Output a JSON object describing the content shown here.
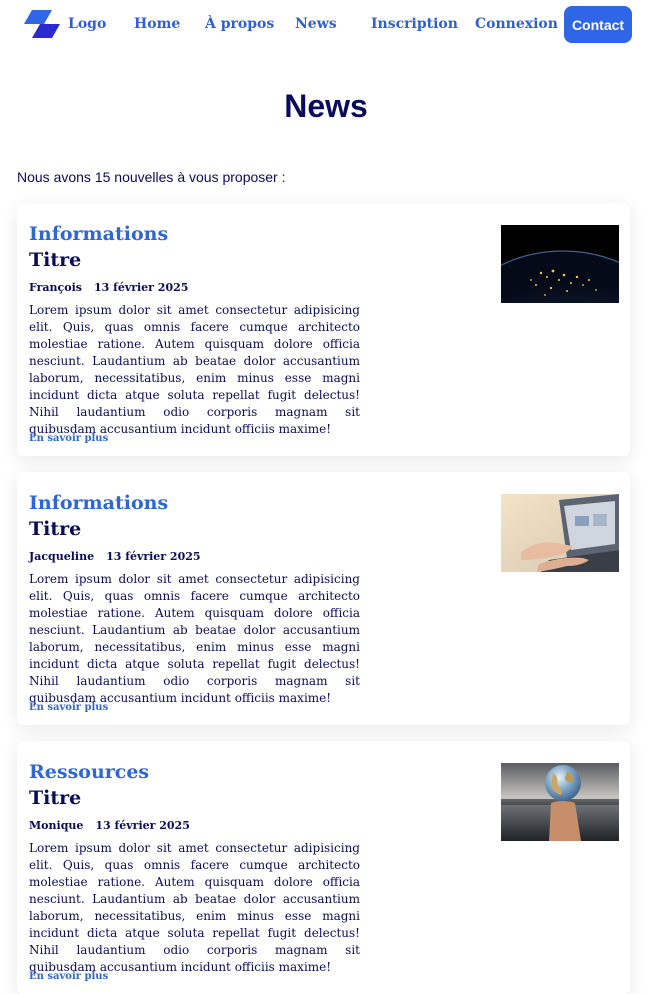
{
  "nav": {
    "logo": "Logo",
    "links": [
      "Home",
      "À propos",
      "News",
      "Inscription",
      "Connexion"
    ],
    "contact": "Contact"
  },
  "page": {
    "title": "News",
    "intro": "Nous avons 15 nouvelles à vous proposer :"
  },
  "articles": [
    {
      "category": "Informations",
      "title": "Titre",
      "author": "François",
      "date": "13 février 2025",
      "body": "Lorem ipsum dolor sit amet consectetur adipisicing elit. Quis, quas omnis facere cumque architecto molestiae ratione. Autem quisquam dolore officia nesciunt. Laudantium ab beatae dolor accusantium laborum, necessitatibus, enim minus esse magni incidunt dicta atque soluta repellat fugit delectus! Nihil laudantium odio corporis magnam sit quibusdam accusantium incidunt officiis maxime!",
      "more": "En savoir plus",
      "image": "earth-at-night-image"
    },
    {
      "category": "Informations",
      "title": "Titre",
      "author": "Jacqueline",
      "date": "13 février 2025",
      "body": "Lorem ipsum dolor sit amet consectetur adipisicing elit. Quis, quas omnis facere cumque architecto molestiae ratione. Autem quisquam dolore officia nesciunt. Laudantium ab beatae dolor accusantium laborum, necessitatibus, enim minus esse magni incidunt dicta atque soluta repellat fugit delectus! Nihil laudantium odio corporis magnam sit quibusdam accusantium incidunt officiis maxime!",
      "more": "En savoir plus",
      "image": "hands-on-laptop-image"
    },
    {
      "category": "Ressources",
      "title": "Titre",
      "author": "Monique",
      "date": "13 février 2025",
      "body": "Lorem ipsum dolor sit amet consectetur adipisicing elit. Quis, quas omnis facere cumque architecto molestiae ratione. Autem quisquam dolore officia nesciunt. Laudantium ab beatae dolor accusantium laborum, necessitatibus, enim minus esse magni incidunt dicta atque soluta repellat fugit delectus! Nihil laudantium odio corporis magnam sit quibusdam accusantium incidunt officiis maxime!",
      "more": "En savoir plus",
      "image": "globe-in-hand-image"
    }
  ]
}
